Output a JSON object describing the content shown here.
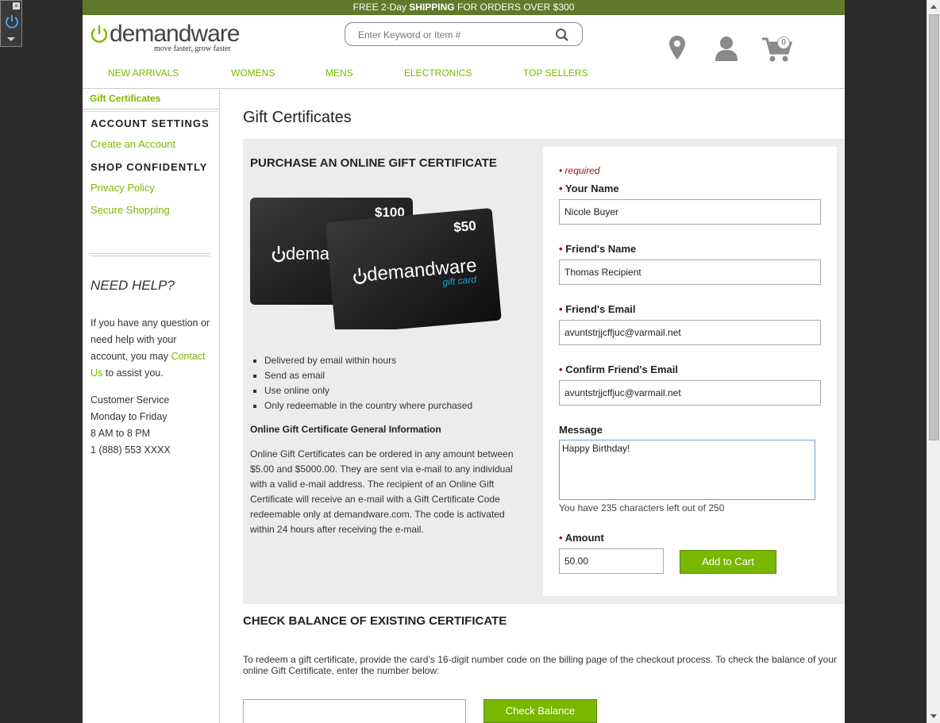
{
  "promo": {
    "prefix": "FREE 2-Day ",
    "bold": "SHIPPING",
    "suffix": " FOR ORDERS OVER $300"
  },
  "logo": {
    "word": "demandware",
    "tagline": "move faster, grow faster"
  },
  "search": {
    "placeholder": "Enter Keyword or Item #"
  },
  "cart": {
    "count": "0"
  },
  "nav": [
    "NEW ARRIVALS",
    "WOMENS",
    "MENS",
    "ELECTRONICS",
    "TOP SELLERS"
  ],
  "breadcrumb": "Gift Certificates",
  "sidebar": {
    "account_heading": "ACCOUNT SETTINGS",
    "create_account": "Create an Account",
    "shop_heading": "SHOP CONFIDENTLY",
    "privacy": "Privacy Policy",
    "secure": "Secure Shopping",
    "need_help": "NEED HELP?",
    "help_text_1": "If you have any question or need help with your account, you may",
    "contact_link": "Contact Us",
    "help_text_2": " to assist you.",
    "service_lines": [
      "Customer Service",
      "Monday to Friday",
      "8 AM to 8 PM",
      "1 (888) 553 XXXX"
    ]
  },
  "main": {
    "title": "Gift Certificates",
    "purchase_heading": "PURCHASE AN ONLINE GIFT CERTIFICATE",
    "card_back_value": "$100",
    "card_front_value": "$50",
    "card_brand": "demandware",
    "card_sub": "gift card",
    "features": [
      "Delivered by email within hours",
      "Send as email",
      "Use online only",
      "Only redeemable in the country where purchased"
    ],
    "general_heading": "Online Gift Certificate General Information",
    "general_text": "Online Gift Certificates can be ordered in any amount between $5.00 and $5000.00. They are sent via e-mail to any individual with a valid e-mail address. The recipient of an Online Gift Certificate will receive an e-mail with a Gift Certificate Code redeemable only at demandware.com. The code is activated within 24 hours after receiving the e-mail."
  },
  "form": {
    "required_note": "• required",
    "your_name_label": "Your Name",
    "your_name_value": "Nicole Buyer",
    "friend_name_label": "Friend's Name",
    "friend_name_value": "Thomas Recipient",
    "friend_email_label": "Friend's Email",
    "friend_email_value": "avuntstrjjcffjuc@varmail.net",
    "confirm_email_label": "Confirm Friend's Email",
    "confirm_email_value": "avuntstrjjcffjuc@varmail.net",
    "message_label": "Message",
    "message_value": "Happy Birthday!",
    "message_count": "You have 235 characters left out of 250",
    "amount_label": "Amount",
    "amount_value": "50.00",
    "add_to_cart": "Add to Cart"
  },
  "check": {
    "heading": "CHECK BALANCE OF EXISTING CERTIFICATE",
    "text": "To redeem a gift certificate, provide the card’s 16-digit number code on the billing page of the checkout process. To check the balance of your online Gift Certificate, enter the number below:",
    "button": "Check Balance"
  },
  "colors": {
    "accent": "#7ab800",
    "promo_bar": "#5f7a2a",
    "required": "#8b1a1a"
  }
}
